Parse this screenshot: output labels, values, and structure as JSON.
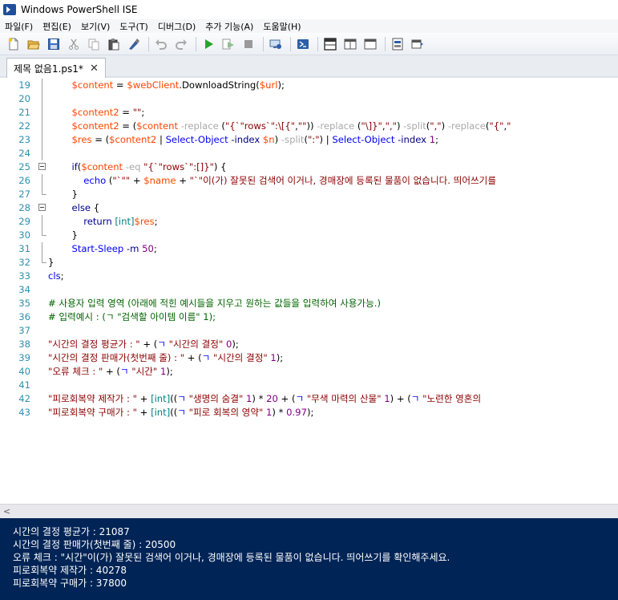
{
  "window": {
    "title": "Windows PowerShell ISE"
  },
  "menu": [
    "파일(F)",
    "편집(E)",
    "보기(V)",
    "도구(T)",
    "디버그(D)",
    "추가 기능(A)",
    "도움말(H)"
  ],
  "toolbar_icons": [
    "new-file-icon",
    "open-folder-icon",
    "save-icon",
    "cut-icon",
    "copy-icon",
    "paste-icon",
    "clear-console-icon",
    "undo-icon",
    "redo-icon",
    "run-icon",
    "run-selection-icon",
    "stop-icon",
    "remote-powershell-icon",
    "powershell-icon",
    "show-script-top-icon",
    "show-script-right-icon",
    "show-script-max-icon",
    "commands-icon",
    "show-addon-icon"
  ],
  "tab": {
    "label": "제목 없음1.ps1*",
    "close": "✕"
  },
  "lines": [
    {
      "n": "19",
      "fold": "line",
      "segs": [
        [
          "pl",
          "        "
        ],
        [
          "var",
          "$content"
        ],
        [
          "pl",
          " = "
        ],
        [
          "var",
          "$webClient"
        ],
        [
          "pl",
          "."
        ],
        [
          "mem",
          "DownloadString"
        ],
        [
          "pl",
          "("
        ],
        [
          "var",
          "$url"
        ],
        [
          "pl",
          ");"
        ]
      ]
    },
    {
      "n": "20",
      "fold": "line",
      "segs": []
    },
    {
      "n": "21",
      "fold": "line",
      "segs": [
        [
          "pl",
          "        "
        ],
        [
          "var",
          "$content2"
        ],
        [
          "pl",
          " = "
        ],
        [
          "str",
          "\"\""
        ],
        [
          "pl",
          ";"
        ]
      ]
    },
    {
      "n": "22",
      "fold": "line",
      "segs": [
        [
          "pl",
          "        "
        ],
        [
          "var",
          "$content2"
        ],
        [
          "pl",
          " = ("
        ],
        [
          "var",
          "$content"
        ],
        [
          "pl",
          " "
        ],
        [
          "op",
          "-replace"
        ],
        [
          "pl",
          " ("
        ],
        [
          "str",
          "\"{`\"rows`\":\\[{\""
        ],
        [
          "pl",
          ","
        ],
        [
          "str",
          "\"\""
        ],
        [
          "pl",
          ")) "
        ],
        [
          "op",
          "-replace"
        ],
        [
          "pl",
          " ("
        ],
        [
          "str",
          "\"\\]}\""
        ],
        [
          "pl",
          ","
        ],
        [
          "str",
          "\",\""
        ],
        [
          "pl",
          ") "
        ],
        [
          "op",
          "-split"
        ],
        [
          "pl",
          "("
        ],
        [
          "str",
          "\",\""
        ],
        [
          "pl",
          ") "
        ],
        [
          "op",
          "-replace"
        ],
        [
          "pl",
          "("
        ],
        [
          "str",
          "\"{\""
        ],
        [
          "pl",
          ","
        ],
        [
          "str",
          "\""
        ]
      ]
    },
    {
      "n": "23",
      "fold": "line",
      "segs": [
        [
          "pl",
          "        "
        ],
        [
          "var",
          "$res"
        ],
        [
          "pl",
          " = ("
        ],
        [
          "var",
          "$content2"
        ],
        [
          "pl",
          " | "
        ],
        [
          "cmd",
          "Select-Object"
        ],
        [
          "pl",
          " "
        ],
        [
          "param",
          "-index"
        ],
        [
          "pl",
          " "
        ],
        [
          "var",
          "$n"
        ],
        [
          "pl",
          ") "
        ],
        [
          "op",
          "-split"
        ],
        [
          "pl",
          "("
        ],
        [
          "str",
          "\":\""
        ],
        [
          "pl",
          ") | "
        ],
        [
          "cmd",
          "Select-Object"
        ],
        [
          "pl",
          " "
        ],
        [
          "param",
          "-index"
        ],
        [
          "pl",
          " "
        ],
        [
          "num",
          "1"
        ],
        [
          "pl",
          ";"
        ]
      ]
    },
    {
      "n": "24",
      "fold": "line",
      "segs": []
    },
    {
      "n": "25",
      "fold": "box",
      "segs": [
        [
          "pl",
          "        "
        ],
        [
          "kw",
          "if"
        ],
        [
          "pl",
          "("
        ],
        [
          "var",
          "$content"
        ],
        [
          "pl",
          " "
        ],
        [
          "op",
          "-eq"
        ],
        [
          "pl",
          " "
        ],
        [
          "str",
          "\"{`\"rows`\":[]}\""
        ],
        [
          "pl",
          ") {"
        ]
      ]
    },
    {
      "n": "26",
      "fold": "line",
      "segs": [
        [
          "pl",
          "            "
        ],
        [
          "cmd",
          "echo"
        ],
        [
          "pl",
          " ("
        ],
        [
          "str",
          "\"`\"\""
        ],
        [
          "pl",
          " + "
        ],
        [
          "var",
          "$name"
        ],
        [
          "pl",
          " + "
        ],
        [
          "str",
          "\"`\"이(가) 잘못된 검색어 이거나, 경매장에 등록된 물품이 없습니다. 띄어쓰기를"
        ]
      ]
    },
    {
      "n": "27",
      "fold": "end",
      "segs": [
        [
          "pl",
          "        }"
        ]
      ]
    },
    {
      "n": "28",
      "fold": "box",
      "segs": [
        [
          "pl",
          "        "
        ],
        [
          "kw",
          "else"
        ],
        [
          "pl",
          " {"
        ]
      ]
    },
    {
      "n": "29",
      "fold": "line",
      "segs": [
        [
          "pl",
          "            "
        ],
        [
          "kw",
          "return"
        ],
        [
          "pl",
          " "
        ],
        [
          "type",
          "[int]"
        ],
        [
          "var",
          "$res"
        ],
        [
          "pl",
          ";"
        ]
      ]
    },
    {
      "n": "30",
      "fold": "end",
      "segs": [
        [
          "pl",
          "        }"
        ]
      ]
    },
    {
      "n": "31",
      "fold": "line",
      "segs": [
        [
          "pl",
          "        "
        ],
        [
          "cmd",
          "Start-Sleep"
        ],
        [
          "pl",
          " "
        ],
        [
          "param",
          "-m"
        ],
        [
          "pl",
          " "
        ],
        [
          "num",
          "50"
        ],
        [
          "pl",
          ";"
        ]
      ]
    },
    {
      "n": "32",
      "fold": "end",
      "segs": [
        [
          "pl",
          "}"
        ]
      ]
    },
    {
      "n": "33",
      "fold": "",
      "segs": [
        [
          "cmd",
          "cls"
        ],
        [
          "pl",
          ";"
        ]
      ]
    },
    {
      "n": "34",
      "fold": "",
      "segs": []
    },
    {
      "n": "35",
      "fold": "",
      "segs": [
        [
          "com",
          "# 사용자 입력 영역 (아래에 적힌 예시들을 지우고 원하는 값들을 입력하여 사용가능.)"
        ]
      ]
    },
    {
      "n": "36",
      "fold": "",
      "segs": [
        [
          "com",
          "# 입력예시 : (ㄱ \"검색할 아이템 이름\" 1);"
        ]
      ]
    },
    {
      "n": "37",
      "fold": "",
      "segs": []
    },
    {
      "n": "38",
      "fold": "",
      "segs": [
        [
          "str",
          "\"시간의 결정 평균가 : \""
        ],
        [
          "pl",
          " + ("
        ],
        [
          "cmd",
          "ㄱ"
        ],
        [
          "pl",
          " "
        ],
        [
          "str",
          "\"시간의 결정\""
        ],
        [
          "pl",
          " "
        ],
        [
          "num",
          "0"
        ],
        [
          "pl",
          ");"
        ]
      ]
    },
    {
      "n": "39",
      "fold": "",
      "segs": [
        [
          "str",
          "\"시간의 결정 판매가(첫번째 줄) : \""
        ],
        [
          "pl",
          " + ("
        ],
        [
          "cmd",
          "ㄱ"
        ],
        [
          "pl",
          " "
        ],
        [
          "str",
          "\"시간의 결정\""
        ],
        [
          "pl",
          " "
        ],
        [
          "num",
          "1"
        ],
        [
          "pl",
          ");"
        ]
      ]
    },
    {
      "n": "40",
      "fold": "",
      "segs": [
        [
          "str",
          "\"오류 체크 : \""
        ],
        [
          "pl",
          " + ("
        ],
        [
          "cmd",
          "ㄱ"
        ],
        [
          "pl",
          " "
        ],
        [
          "str",
          "\"시간\""
        ],
        [
          "pl",
          " "
        ],
        [
          "num",
          "1"
        ],
        [
          "pl",
          ");"
        ]
      ]
    },
    {
      "n": "41",
      "fold": "",
      "segs": []
    },
    {
      "n": "42",
      "fold": "",
      "segs": [
        [
          "str",
          "\"피로회복약 제작가 : \""
        ],
        [
          "pl",
          " + "
        ],
        [
          "type",
          "[int]"
        ],
        [
          "pl",
          "(("
        ],
        [
          "cmd",
          "ㄱ"
        ],
        [
          "pl",
          " "
        ],
        [
          "str",
          "\"생명의 숨결\""
        ],
        [
          "pl",
          " "
        ],
        [
          "num",
          "1"
        ],
        [
          "pl",
          ") * "
        ],
        [
          "num",
          "20"
        ],
        [
          "pl",
          " + ("
        ],
        [
          "cmd",
          "ㄱ"
        ],
        [
          "pl",
          " "
        ],
        [
          "str",
          "\"무색 마력의 산물\""
        ],
        [
          "pl",
          " "
        ],
        [
          "num",
          "1"
        ],
        [
          "pl",
          ") + ("
        ],
        [
          "cmd",
          "ㄱ"
        ],
        [
          "pl",
          " "
        ],
        [
          "str",
          "\"노련한 영혼의"
        ]
      ]
    },
    {
      "n": "43",
      "fold": "",
      "segs": [
        [
          "str",
          "\"피로회복약 구매가 : \""
        ],
        [
          "pl",
          " + "
        ],
        [
          "type",
          "[int]"
        ],
        [
          "pl",
          "(("
        ],
        [
          "cmd",
          "ㄱ"
        ],
        [
          "pl",
          " "
        ],
        [
          "str",
          "\"피로 회복의 영약\""
        ],
        [
          "pl",
          " "
        ],
        [
          "num",
          "1"
        ],
        [
          "pl",
          ") * "
        ],
        [
          "num",
          "0.97"
        ],
        [
          "pl",
          ");"
        ]
      ]
    }
  ],
  "scroll": {
    "left_arrow": "<"
  },
  "console": [
    "시간의 결정 평균가 : 21087",
    "시간의 결정 판매가(첫번째 줄) : 20500",
    "오류 체크 : \"시간\"이(가) 잘못된 검색어 이거나, 경매장에 등록된 물품이 없습니다. 띄어쓰기를 확인해주세요.",
    "피로회복약 제작가 : 40278",
    "피로회복약 구매가 : 37800"
  ]
}
